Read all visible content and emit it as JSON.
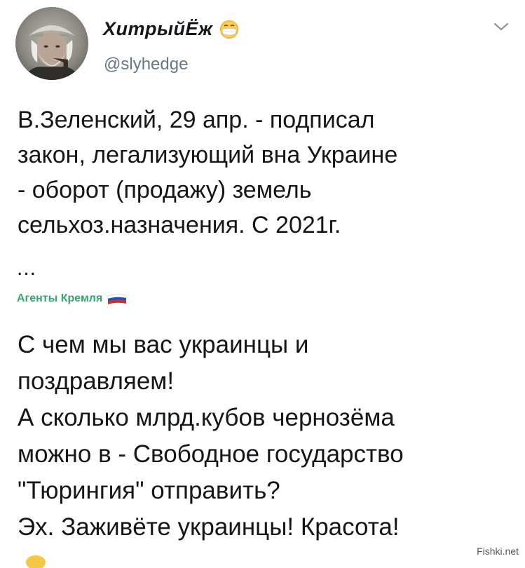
{
  "author": {
    "display_name": "ХитрыйЁж",
    "handle": "@slyhedge"
  },
  "tweet": {
    "lines": [
      "В.Зеленский, 29 апр. - подписал",
      "закон, легализующий вна Украине",
      "- оборот (продажу) земель",
      "сельхоз.назначения. С 2021г."
    ],
    "ellipsis": "...",
    "tag": "Агенты Кремля"
  },
  "comment": {
    "lines": [
      "С чем мы вас украинцы и",
      "поздравляем!",
      "А сколько млрд.кубов чернозёма",
      "можно в - Свободное государство",
      "\"Тюрингия\" отправить?",
      "Эх. Заживёте украинцы! Красота!"
    ]
  },
  "watermark": "Fishki.net",
  "icons": {
    "avatar": "old-man-avatar",
    "status_emoji": "mask-face-emoji",
    "menu": "chevron-down-icon",
    "tag_flag": "russian-flag-icon"
  },
  "colors": {
    "text": "#14171a",
    "handle": "#657786",
    "tag": "#34a870",
    "chevron": "#8899a6"
  }
}
